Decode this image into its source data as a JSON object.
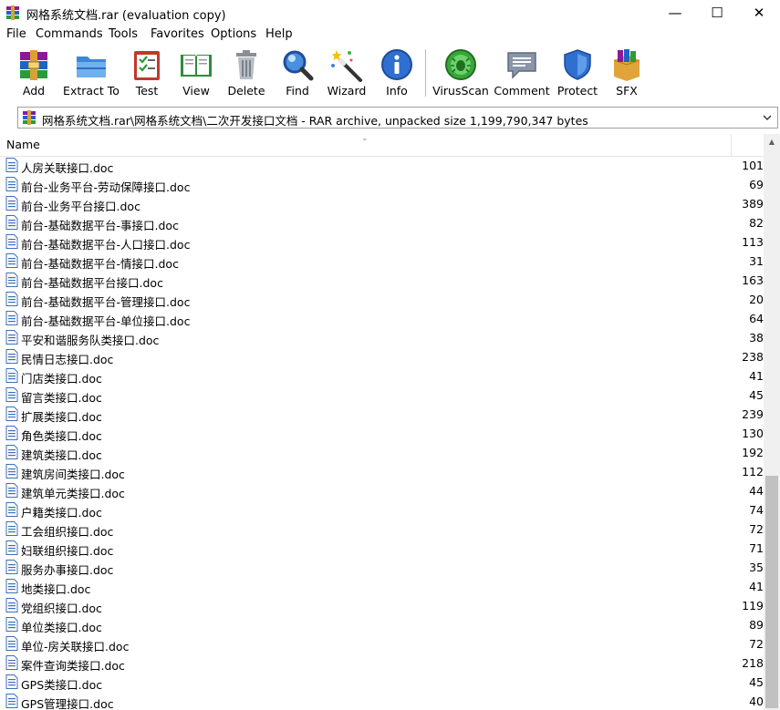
{
  "window": {
    "title": "网格系统文档.rar (evaluation copy)",
    "minimize_glyph": "—",
    "maximize_glyph": "☐",
    "close_glyph": "✕"
  },
  "menu": [
    "File",
    "Commands",
    "Tools",
    "Favorites",
    "Options",
    "Help"
  ],
  "toolbar": [
    {
      "label": "Add",
      "icon": "add-archive-icon"
    },
    {
      "label": "Extract To",
      "icon": "extract-folder-icon"
    },
    {
      "label": "Test",
      "icon": "test-checklist-icon"
    },
    {
      "label": "View",
      "icon": "view-book-icon"
    },
    {
      "label": "Delete",
      "icon": "trash-can-icon"
    },
    {
      "label": "Find",
      "icon": "magnifier-icon"
    },
    {
      "label": "Wizard",
      "icon": "magic-wand-icon"
    },
    {
      "label": "Info",
      "icon": "info-icon"
    },
    {
      "label": "VirusScan",
      "icon": "virus-scan-icon"
    },
    {
      "label": "Comment",
      "icon": "comment-bubble-icon"
    },
    {
      "label": "Protect",
      "icon": "shield-icon"
    },
    {
      "label": "SFX",
      "icon": "sfx-box-icon"
    }
  ],
  "address": {
    "path": "网格系统文档.rar\\网格系统文档\\二次开发接口文档 - RAR archive, unpacked size 1,199,790,347 bytes"
  },
  "list": {
    "column_name": "Name",
    "sort_indicator": "⌄",
    "rows": [
      {
        "name": "人房关联接口.doc",
        "size": "101"
      },
      {
        "name": "前台-业务平台-劳动保障接口.doc",
        "size": "69"
      },
      {
        "name": "前台-业务平台接口.doc",
        "size": "389"
      },
      {
        "name": "前台-基础数据平台-事接口.doc",
        "size": "82"
      },
      {
        "name": "前台-基础数据平台-人口接口.doc",
        "size": "113"
      },
      {
        "name": "前台-基础数据平台-情接口.doc",
        "size": "31"
      },
      {
        "name": "前台-基础数据平台接口.doc",
        "size": "163"
      },
      {
        "name": "前台-基础数据平台-管理接口.doc",
        "size": "20"
      },
      {
        "name": "前台-基础数据平台-单位接口.doc",
        "size": "64"
      },
      {
        "name": "平安和谐服务队类接口.doc",
        "size": "38"
      },
      {
        "name": "民情日志接口.doc",
        "size": "238"
      },
      {
        "name": "门店类接口.doc",
        "size": "41"
      },
      {
        "name": "留言类接口.doc",
        "size": "45"
      },
      {
        "name": "扩展类接口.doc",
        "size": "239"
      },
      {
        "name": "角色类接口.doc",
        "size": "130"
      },
      {
        "name": "建筑类接口.doc",
        "size": "192"
      },
      {
        "name": "建筑房间类接口.doc",
        "size": "112"
      },
      {
        "name": "建筑单元类接口.doc",
        "size": "44"
      },
      {
        "name": "户籍类接口.doc",
        "size": "74"
      },
      {
        "name": "工会组织接口.doc",
        "size": "72"
      },
      {
        "name": "妇联组织接口.doc",
        "size": "71"
      },
      {
        "name": "服务办事接口.doc",
        "size": "35"
      },
      {
        "name": "地类接口.doc",
        "size": "41"
      },
      {
        "name": "党组织接口.doc",
        "size": "119"
      },
      {
        "name": "单位类接口.doc",
        "size": "89"
      },
      {
        "name": "单位-房关联接口.doc",
        "size": "72"
      },
      {
        "name": "案件查询类接口.doc",
        "size": "218"
      },
      {
        "name": "GPS类接口.doc",
        "size": "45"
      },
      {
        "name": "GPS管理接口.doc",
        "size": "40"
      }
    ]
  },
  "scrollbar": {
    "up_glyph": "▲"
  }
}
